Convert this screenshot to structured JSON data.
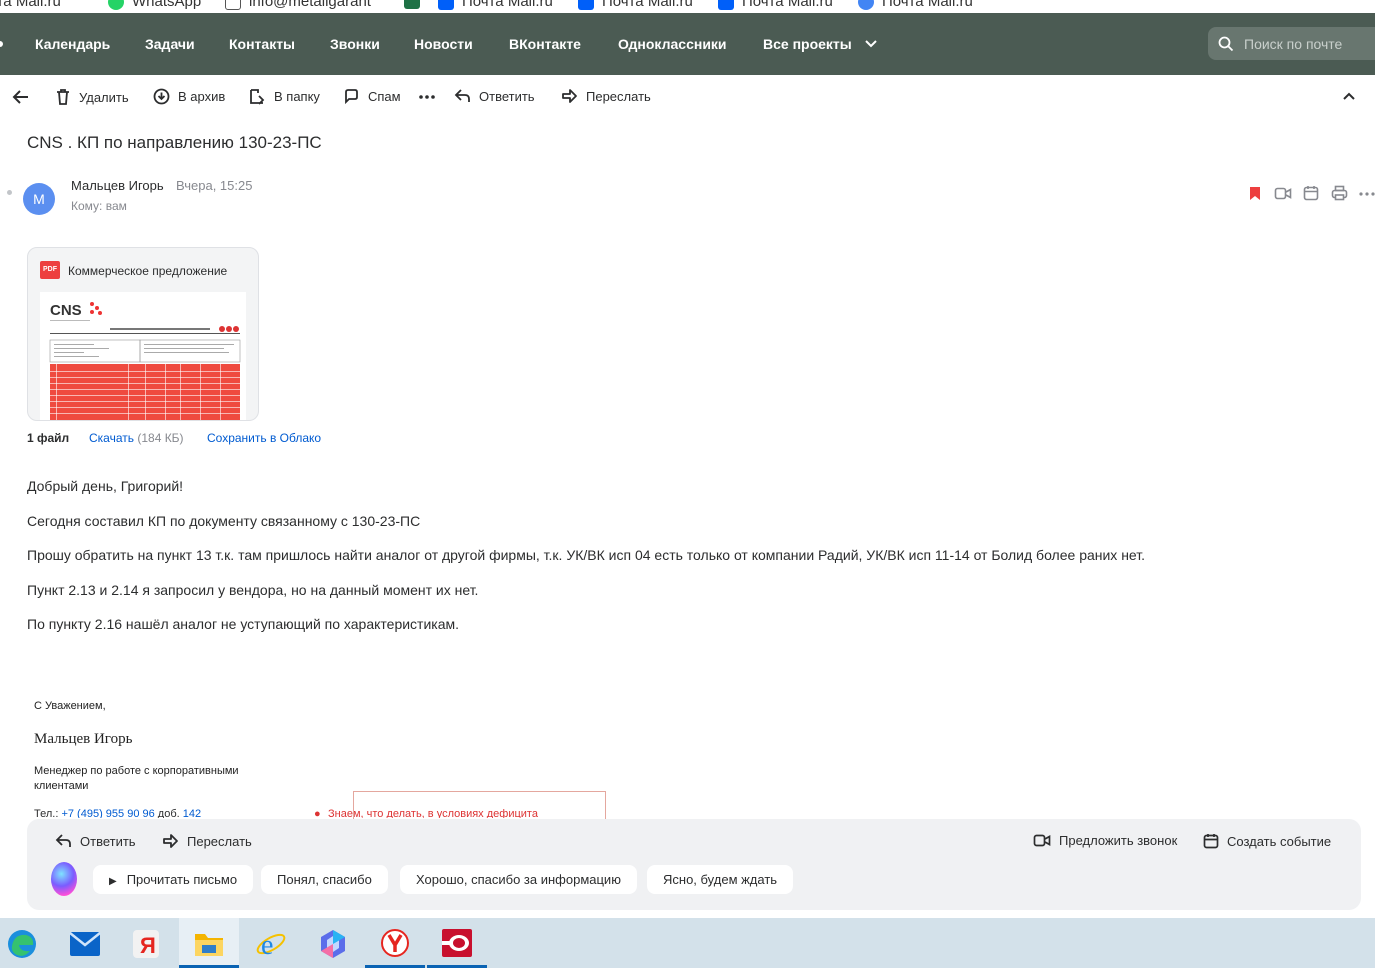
{
  "bookmarks": [
    {
      "label": "Почта Mail.ru",
      "icon": "mail-icon"
    },
    {
      "label": "WhatsApp",
      "icon": "whatsapp-icon"
    },
    {
      "label": "info@metallgarant",
      "icon": "doc-icon"
    },
    {
      "label": "",
      "icon": "excel-icon"
    },
    {
      "label": "Почта Mail.ru",
      "icon": "mailru-icon"
    },
    {
      "label": "Почта Mail.ru",
      "icon": "mailru-icon"
    },
    {
      "label": "Почта Mail.ru",
      "icon": "mailru-icon"
    },
    {
      "label": "Почта Mail.ru",
      "icon": "google-icon"
    }
  ],
  "nav": {
    "items": [
      "Календарь",
      "Задачи",
      "Контакты",
      "Звонки",
      "Новости",
      "ВКонтакте",
      "Одноклассники",
      "Все проекты"
    ],
    "search_placeholder": "Поиск по почте"
  },
  "toolbar": {
    "delete": "Удалить",
    "archive": "В архив",
    "to_folder": "В папку",
    "spam": "Спам",
    "reply": "Ответить",
    "forward": "Переслать"
  },
  "message": {
    "subject": "CNS . КП по направлению 130-23-ПС",
    "avatar_letter": "М",
    "sender": "Мальцев Игорь",
    "time": "Вчера, 15:25",
    "to": "Кому: вам"
  },
  "attachment": {
    "name": "Коммерческое предложение",
    "type_label": "PDF",
    "preview_logo": "CNS",
    "files_count": "1 файл",
    "download": "Скачать",
    "size": "(184 КБ)",
    "save_cloud": "Сохранить в Облако"
  },
  "body": [
    "Добрый день, Григорий!",
    "Сегодня составил КП по документу связанному с 130-23-ПС",
    "Прошу обратить на пункт 13 т.к. там пришлось найти аналог от другой фирмы, т.к. УК/ВК исп 04 есть только от компании Радий, УК/ВК исп 11-14 от Болид более раних нет.",
    "Пункт 2.13 и 2.14 я запросил у вендора, но на данный момент их нет.",
    "По пункту 2.16 нашёл аналог не уступающий по характеристикам."
  ],
  "signature": {
    "greeting": "С Уважением,",
    "name": "Мальцев Игорь",
    "role_line1": "Менеджер по работе с корпоративными",
    "role_line2": "клиентами",
    "phone_prefix": "Тел.:",
    "phone": "+7 (495) 955 90 96",
    "ext_label": "доб.",
    "ext": "142",
    "promo": "Знаем, что делать, в условиях дефицита"
  },
  "reply_panel": {
    "reply": "Ответить",
    "forward": "Переслать",
    "suggest_call": "Предложить звонок",
    "create_event": "Создать событие",
    "read_aloud": "Прочитать письмо",
    "quick_replies": [
      "Понял, спасибо",
      "Хорошо, спасибо за информацию",
      "Ясно, будем ждать"
    ]
  },
  "colors": {
    "nav_bg": "#4b5b53",
    "link": "#005bd1",
    "bookmark_flag": "#ed3f3f",
    "avatar": "#5b8ff0"
  },
  "taskbar_apps": [
    "edge-icon",
    "mail-app-icon",
    "yandex-browser-icon",
    "file-explorer-icon",
    "internet-explorer-icon",
    "copilot-icon",
    "yandex-icon",
    "app-red-icon"
  ]
}
